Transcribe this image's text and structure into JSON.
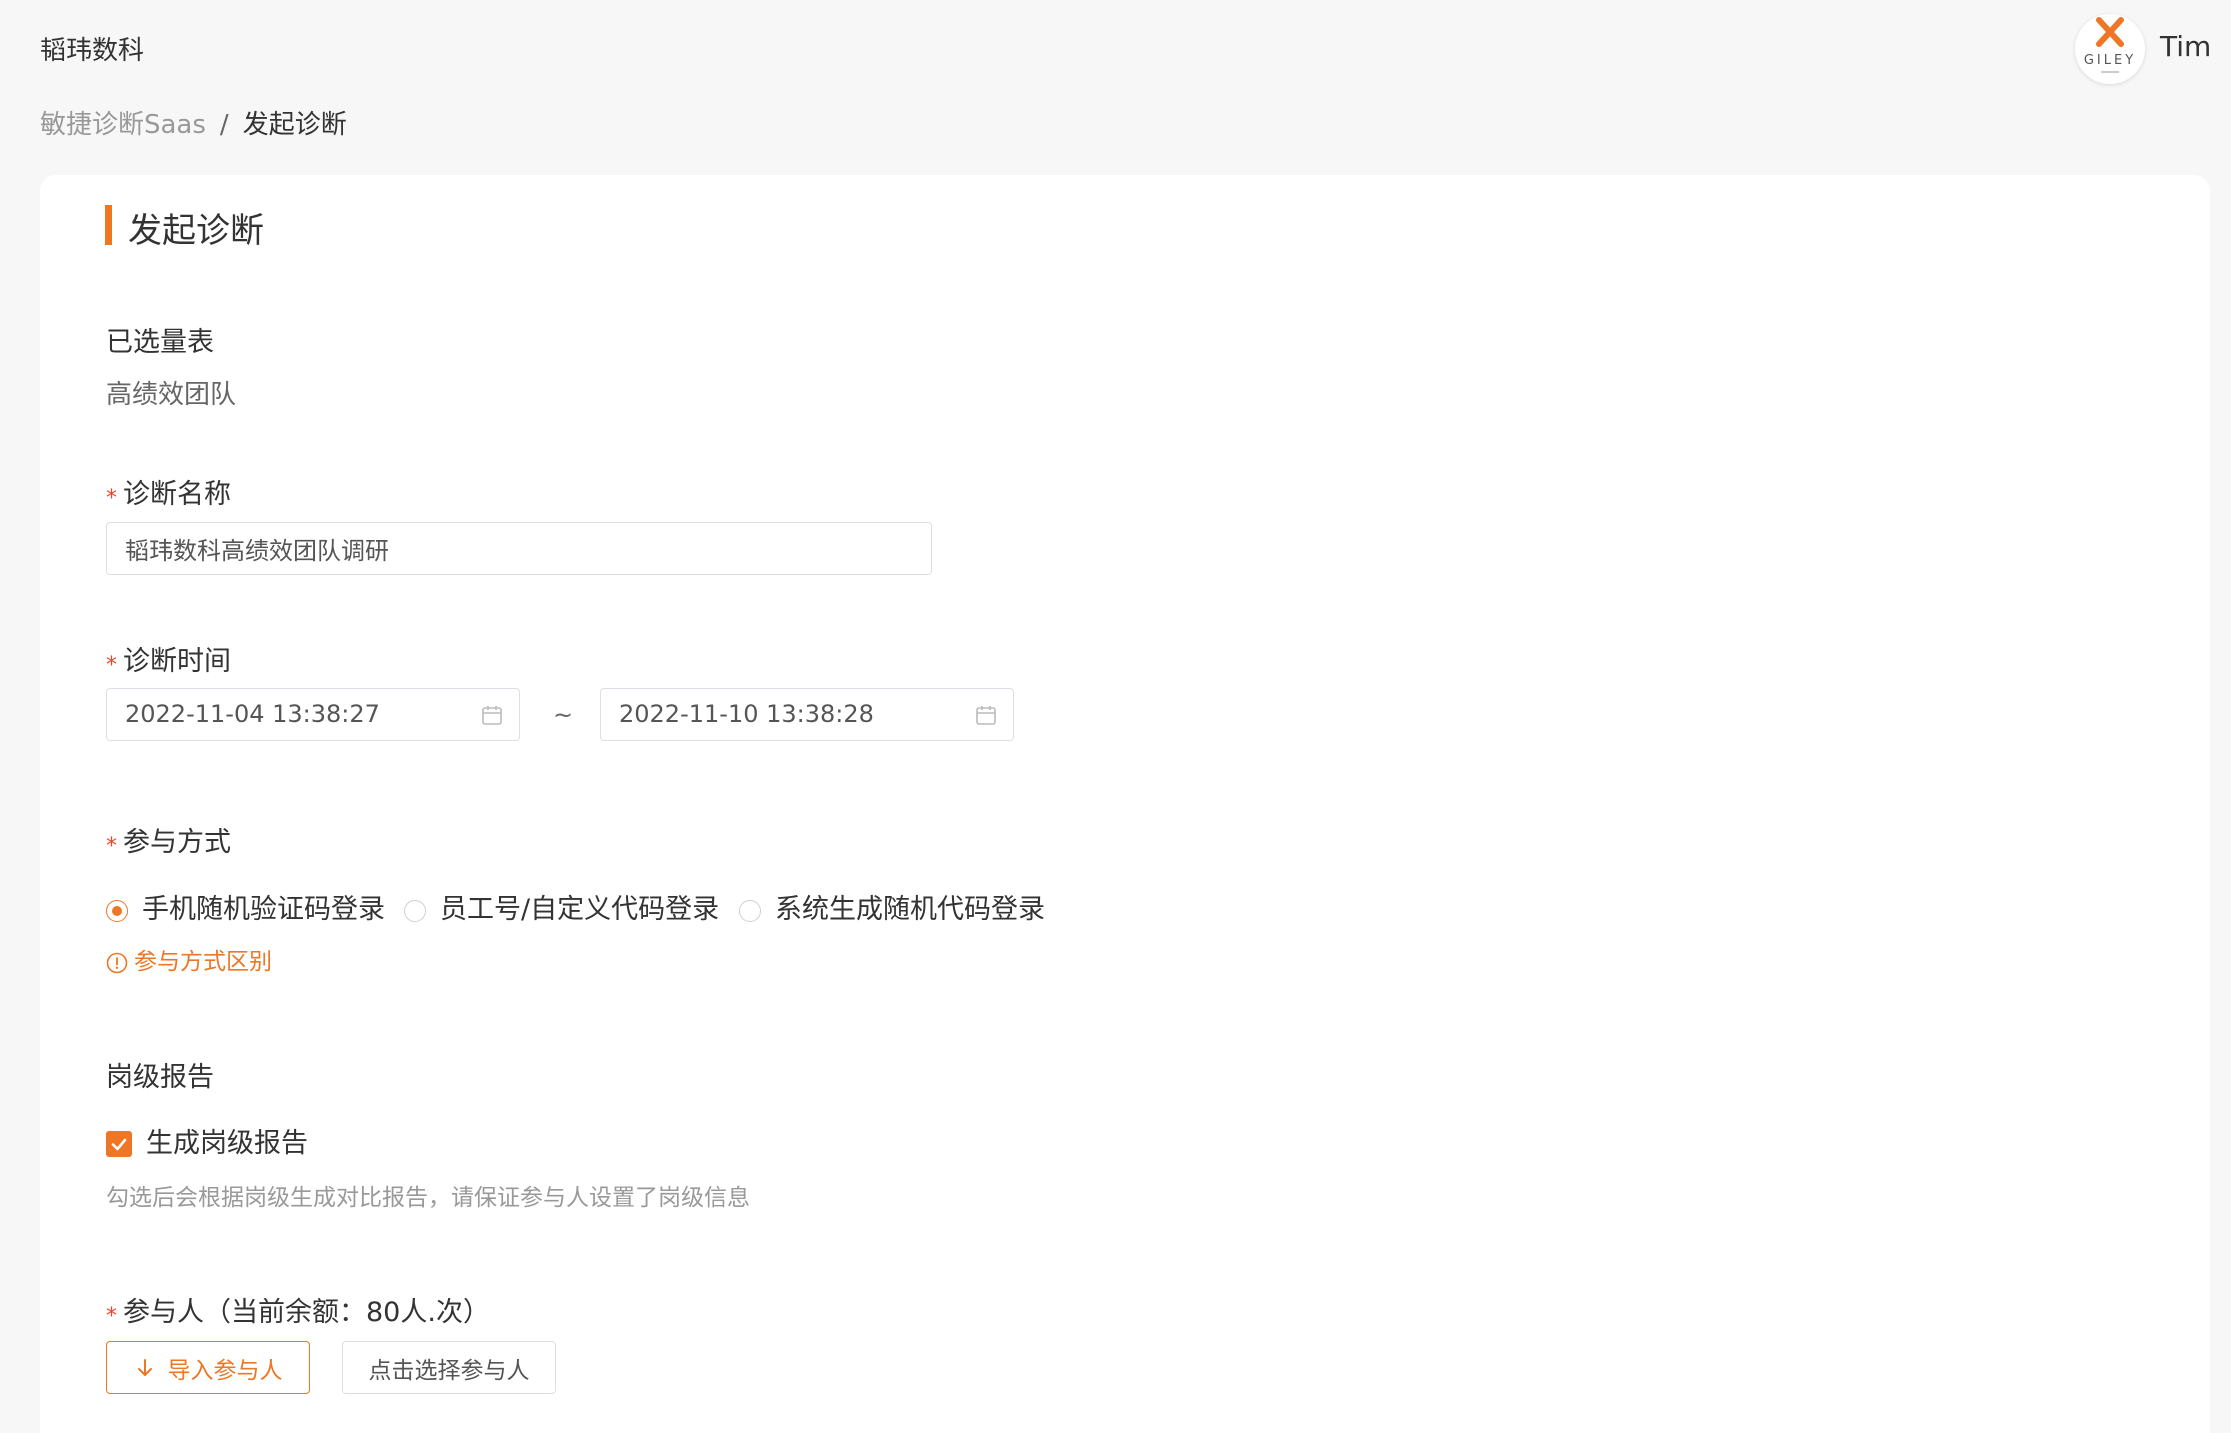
{
  "header": {
    "brand": "韬玮数科",
    "user_name": "Tim",
    "avatar_logo_text": "GILEY"
  },
  "breadcrumb": {
    "root": "敏捷诊断Saas",
    "separator": "/",
    "current": "发起诊断"
  },
  "page": {
    "title": "发起诊断"
  },
  "form": {
    "selected_scale": {
      "label": "已选量表",
      "value": "高绩效团队"
    },
    "diagnosis_name": {
      "required_mark": "*",
      "label": "诊断名称",
      "value": "韬玮数科高绩效团队调研"
    },
    "diagnosis_time": {
      "required_mark": "*",
      "label": "诊断时间",
      "start": "2022-11-04 13:38:27",
      "separator": "~",
      "end": "2022-11-10 13:38:28"
    },
    "participation": {
      "required_mark": "*",
      "label": "参与方式",
      "options": [
        {
          "label": "手机随机验证码登录",
          "checked": true
        },
        {
          "label": "员工号/自定义代码登录",
          "checked": false
        },
        {
          "label": "系统生成随机代码登录",
          "checked": false
        }
      ],
      "diff_link": "参与方式区别"
    },
    "level_report": {
      "label": "岗级报告",
      "checkbox_label": "生成岗级报告",
      "checked": true,
      "hint": "勾选后会根据岗级生成对比报告，请保证参与人设置了岗级信息"
    },
    "participants": {
      "required_mark": "*",
      "label": "参与人（当前余额：80人.次）",
      "import_button": "导入参与人",
      "select_button": "点击选择参与人"
    }
  },
  "colors": {
    "accent": "#ee7624",
    "required": "#e8472d",
    "border": "#dcdfe6"
  },
  "icons": {
    "calendar": "calendar-icon",
    "warning": "info-circle-icon",
    "import": "arrow-down-icon",
    "check": "check-icon"
  }
}
